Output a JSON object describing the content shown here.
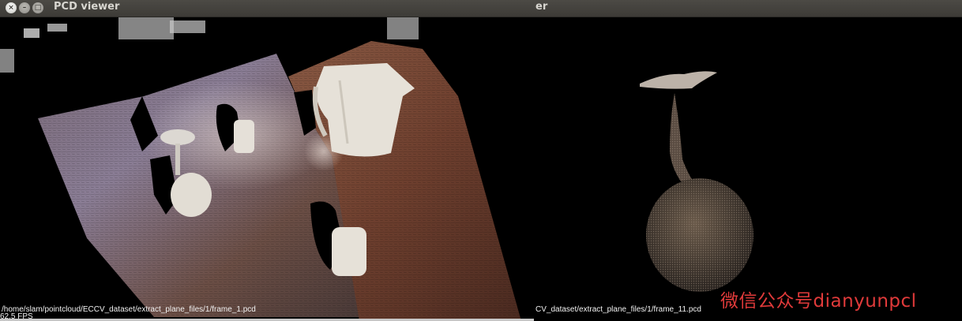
{
  "left_window": {
    "title": "PCD viewer",
    "close_glyph": "×",
    "minimize_glyph": "–",
    "maximize_glyph": "□",
    "file_path": "/home/slam/pointcloud/ECCV_dataset/extract_plane_files/1/frame_1.pcd",
    "fps": "62.5 FPS"
  },
  "right_window": {
    "title": "er",
    "file_path": "CV_dataset/extract_plane_files/1/frame_11.pcd",
    "watermark": "微信公众号dianyunpcl"
  },
  "colors": {
    "titlebar": "#3d3b37",
    "title_text": "#d8d6d0",
    "viewport_bg": "#000000",
    "table_surface": "#6e4a3a",
    "object_white": "#e8e4dc",
    "watermark": "#e03a3a"
  }
}
